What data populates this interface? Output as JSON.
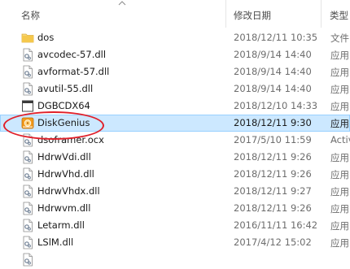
{
  "columns": {
    "name": "名称",
    "date": "修改日期",
    "type": "类型"
  },
  "files": [
    {
      "name": "dos",
      "date": "2018/12/11 10:35",
      "type": "文件",
      "icon": "folder-icon"
    },
    {
      "name": "avcodec-57.dll",
      "date": "2018/9/14 14:40",
      "type": "应用",
      "icon": "dll-file-icon"
    },
    {
      "name": "avformat-57.dll",
      "date": "2018/9/14 14:40",
      "type": "应用",
      "icon": "dll-file-icon"
    },
    {
      "name": "avutil-55.dll",
      "date": "2018/9/14 14:40",
      "type": "应用",
      "icon": "dll-file-icon"
    },
    {
      "name": "DGBCDX64",
      "date": "2018/12/10 14:33",
      "type": "应用",
      "icon": "exe-file-icon"
    },
    {
      "name": "DiskGenius",
      "date": "2018/12/11 9:30",
      "type": "应用",
      "icon": "diskgenius-app-icon"
    },
    {
      "name": "dsoframer.ocx",
      "date": "2017/5/10 11:59",
      "type": "Activ",
      "icon": "dll-file-icon"
    },
    {
      "name": "HdrwVdi.dll",
      "date": "2018/12/11 9:26",
      "type": "应用",
      "icon": "dll-file-icon"
    },
    {
      "name": "HdrwVhd.dll",
      "date": "2018/12/11 9:26",
      "type": "应用",
      "icon": "dll-file-icon"
    },
    {
      "name": "HdrwVhdx.dll",
      "date": "2018/12/11 9:27",
      "type": "应用",
      "icon": "dll-file-icon"
    },
    {
      "name": "Hdrwvm.dll",
      "date": "2018/12/11 9:26",
      "type": "应用",
      "icon": "dll-file-icon"
    },
    {
      "name": "Letarm.dll",
      "date": "2016/11/11 16:42",
      "type": "应用",
      "icon": "dll-file-icon"
    },
    {
      "name": "LSlM.dll",
      "date": "2017/4/12 15:02",
      "type": "应用",
      "icon": "dll-file-icon"
    },
    {
      "name": "",
      "date": "",
      "type": "",
      "icon": "dll-file-icon"
    }
  ],
  "selected": "DiskGenius",
  "colors": {
    "selection": "#cce8ff",
    "selection_border": "#99d1ff",
    "annotation": "#e0202a",
    "folder": "#f5c84c"
  }
}
